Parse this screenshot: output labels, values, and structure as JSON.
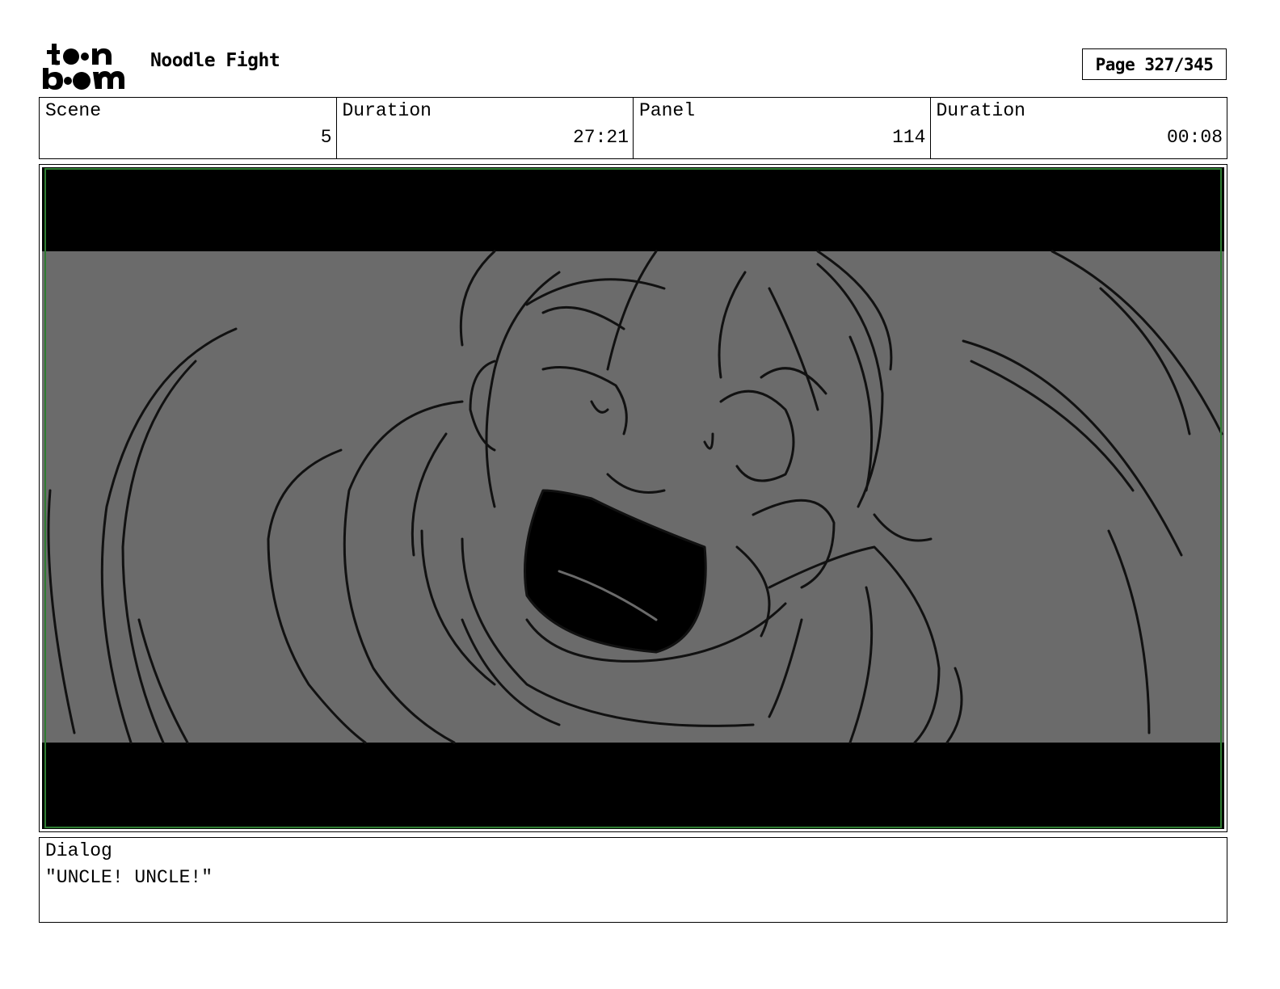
{
  "header": {
    "logo": "toon boom",
    "project_title": "Noodle Fight",
    "page_label": "Page 327/345"
  },
  "info": {
    "scene_label": "Scene",
    "scene_value": "5",
    "scene_duration_label": "Duration",
    "scene_duration_value": "27:21",
    "panel_label": "Panel",
    "panel_value": "114",
    "panel_duration_label": "Duration",
    "panel_duration_value": "00:08"
  },
  "panel": {
    "image_description_icon": "storyboard-sketch",
    "letterbox_color": "#000000",
    "background_color": "#6b6b6b",
    "safe_frame_color": "#2e7d32"
  },
  "dialog": {
    "label": "Dialog",
    "text": "\"UNCLE! UNCLE!\""
  }
}
